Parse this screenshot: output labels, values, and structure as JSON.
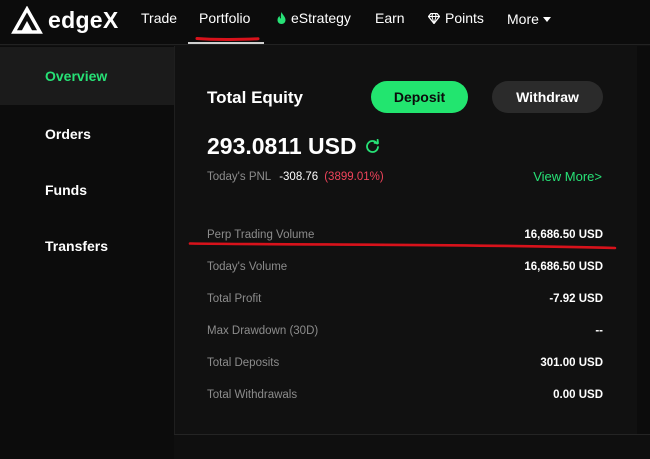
{
  "brand": {
    "name": "edgeX"
  },
  "nav": {
    "items": [
      {
        "label": "Trade"
      },
      {
        "label": "Portfolio",
        "active": true
      },
      {
        "label": "eStrategy",
        "icon": "flame-icon"
      },
      {
        "label": "Earn"
      },
      {
        "label": "Points",
        "icon": "diamond-icon"
      },
      {
        "label": "More",
        "icon": "caret-down-icon"
      }
    ]
  },
  "sidebar": {
    "items": [
      {
        "label": "Overview",
        "active": true
      },
      {
        "label": "Orders"
      },
      {
        "label": "Funds"
      },
      {
        "label": "Transfers"
      }
    ]
  },
  "overview": {
    "title": "Total Equity",
    "deposit_label": "Deposit",
    "withdraw_label": "Withdraw",
    "equity_value": "293.0811 USD",
    "pnl_label": "Today's PNL",
    "pnl_value": "-308.76",
    "pnl_pct": "(3899.01%)",
    "view_more_label": "View More>",
    "stats": [
      {
        "label": "Perp Trading Volume",
        "value": "16,686.50 USD"
      },
      {
        "label": "Today's Volume",
        "value": "16,686.50 USD"
      },
      {
        "label": "Total Profit",
        "value": "-7.92 USD"
      },
      {
        "label": "Max Drawdown (30D)",
        "value": "--"
      },
      {
        "label": "Total Deposits",
        "value": "301.00 USD"
      },
      {
        "label": "Total Withdrawals",
        "value": "0.00 USD"
      }
    ]
  },
  "colors": {
    "accent_green": "#22e56f",
    "negative_red": "#f0445b",
    "background": "#111111",
    "annotation_red": "#d8121b"
  }
}
